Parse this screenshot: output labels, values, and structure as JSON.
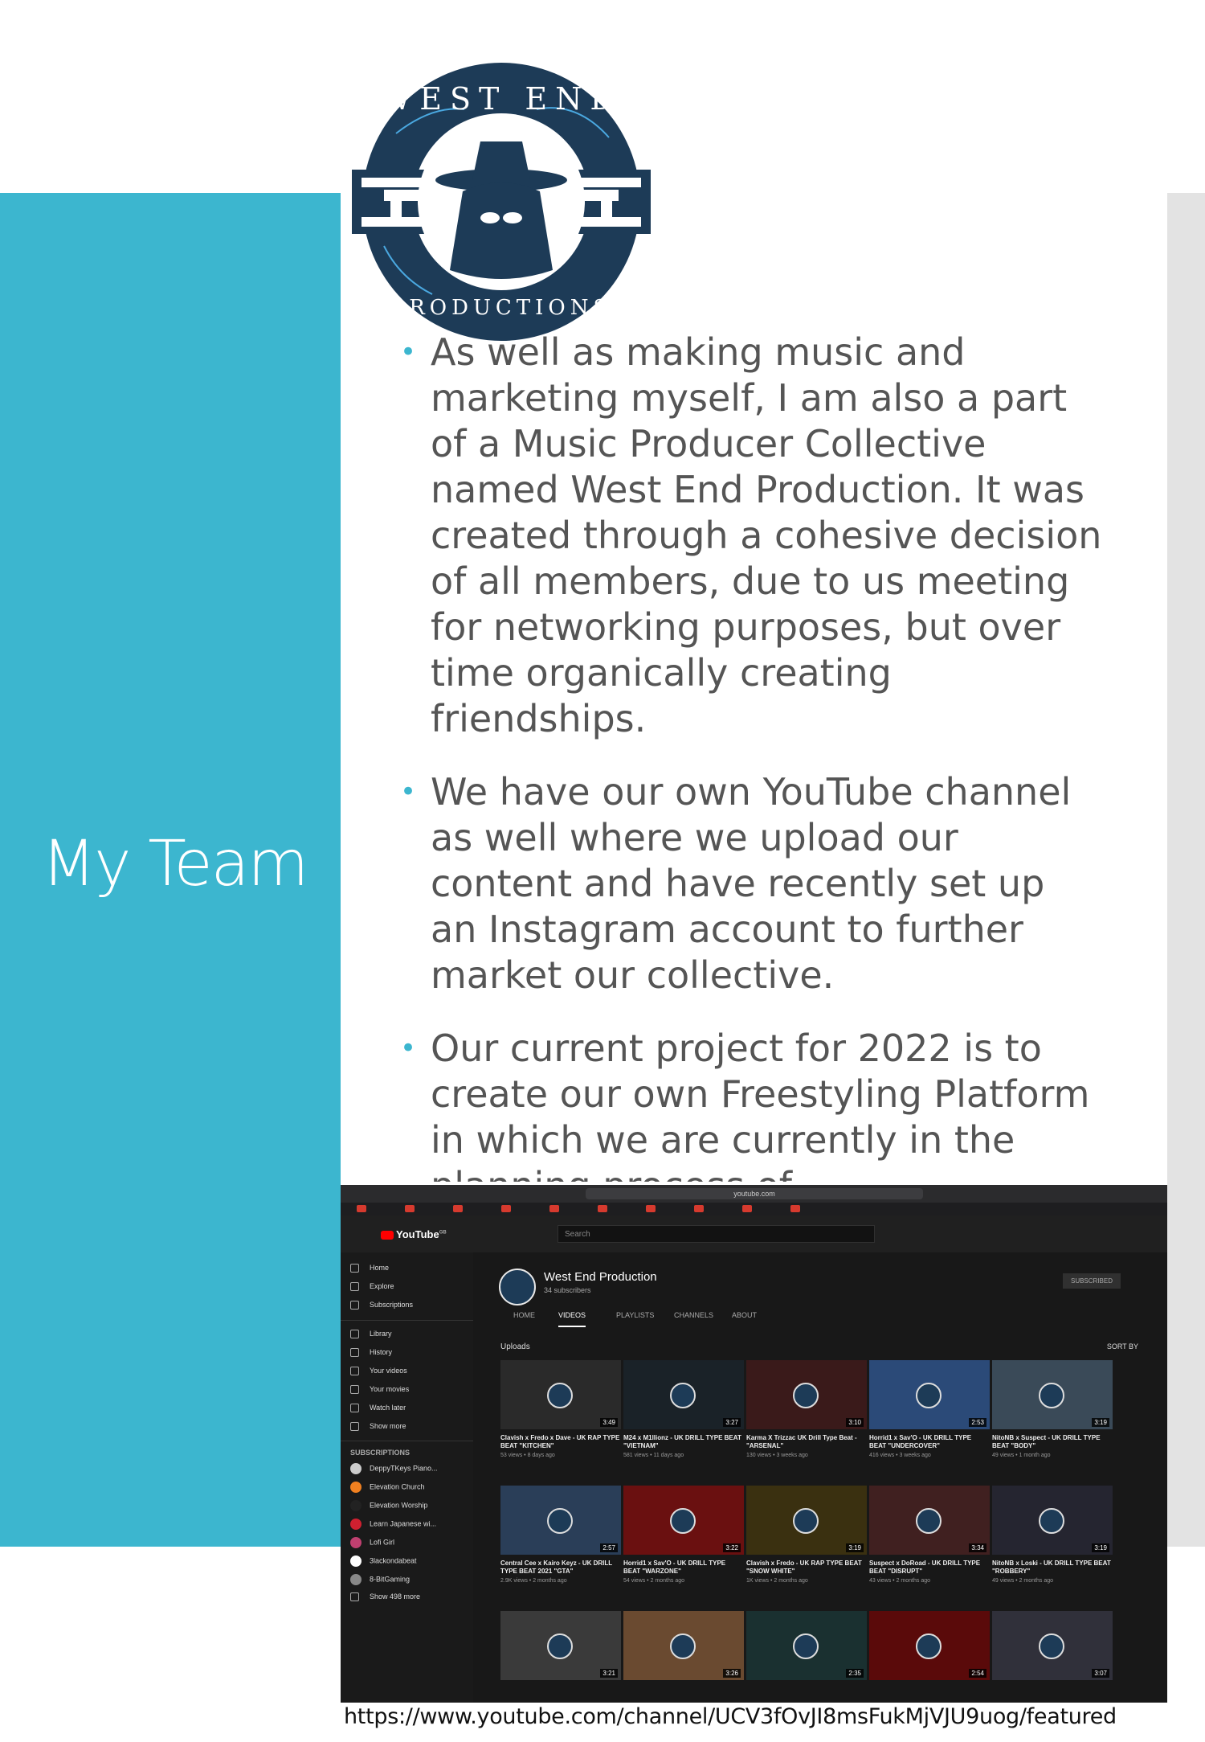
{
  "slide": {
    "title": "My Team",
    "bullets": [
      "As well as making music and marketing myself, I am also a part of a Music Producer Collective named West End Production. It was created through a cohesive decision of all members, due to us meeting for networking purposes, but over time organically creating friendships.",
      "We have our own YouTube channel as well where we upload our content and have recently set up an Instagram account to further market our collective.",
      "Our current project for 2022 is to create our own Freestyling Platform in which we are currently in the planning process of."
    ],
    "link": "https://www.youtube.com/channel/UCV3fOvJI8msFukMjVJU9uog/featured",
    "logo": {
      "top_text": "WEST END",
      "bottom_text": "PRODUCTIONS"
    },
    "colors": {
      "accent": "#3cb6cf",
      "text": "#555555",
      "logo_navy": "#1d3b57"
    }
  },
  "youtube": {
    "url": "youtube.com",
    "logo_text": "YouTube",
    "logo_sup": "GB",
    "search_placeholder": "Search",
    "sidebar": {
      "main": [
        "Home",
        "Explore",
        "Subscriptions"
      ],
      "library": [
        "Library",
        "History",
        "Your videos",
        "Your movies",
        "Watch later",
        "Show more"
      ],
      "subscriptions_label": "SUBSCRIPTIONS",
      "subscriptions": [
        "DeppyTKeys Piano...",
        "Elevation Church",
        "Elevation Worship",
        "Learn Japanese wi...",
        "Lofi Girl",
        "3lackondabeat",
        "8-BitGaming",
        "Show 498 more"
      ]
    },
    "channel": {
      "name": "West End Production",
      "subs": "34 subscribers",
      "subscribe_label": "SUBSCRIBED",
      "tabs": [
        "HOME",
        "VIDEOS",
        "PLAYLISTS",
        "CHANNELS",
        "ABOUT"
      ],
      "uploads_label": "Uploads",
      "sort_label": "SORT BY"
    },
    "videos": [
      {
        "title": "Clavish x Fredo x Dave - UK RAP TYPE BEAT \"KITCHEN\"",
        "meta": "53 views • 8 days ago",
        "dur": "3:49",
        "color": "#2a2a2a"
      },
      {
        "title": "M24 x M1llionz - UK DRILL TYPE BEAT \"VIETNAM\"",
        "meta": "581 views • 11 days ago",
        "dur": "3:27",
        "color": "#1a2228"
      },
      {
        "title": "Karma X Trizzac UK Drill Type Beat - \"ARSENAL\"",
        "meta": "130 views • 3 weeks ago",
        "dur": "3:10",
        "color": "#3a1a1a"
      },
      {
        "title": "Horrid1 x Sav'O - UK DRILL TYPE BEAT \"UNDERCOVER\"",
        "meta": "416 views • 3 weeks ago",
        "dur": "2:53",
        "color": "#2b4a78"
      },
      {
        "title": "NitoNB x Suspect - UK DRILL TYPE BEAT \"BODY\"",
        "meta": "49 views • 1 month ago",
        "dur": "3:19",
        "color": "#3a4a58"
      },
      {
        "title": "Central Cee x Kairo Keyz - UK DRILL TYPE BEAT 2021 \"GTA\"",
        "meta": "2.9K views • 2 months ago",
        "dur": "2:57",
        "color": "#2a3e58"
      },
      {
        "title": "Horrid1 x Sav'O - UK DRILL TYPE BEAT \"WARZONE\"",
        "meta": "54 views • 2 months ago",
        "dur": "3:22",
        "color": "#6a1010"
      },
      {
        "title": "Clavish x Fredo - UK RAP TYPE BEAT \"SNOW WHITE\"",
        "meta": "1K views • 2 months ago",
        "dur": "3:19",
        "color": "#3a3010"
      },
      {
        "title": "Suspect x DoRoad - UK DRILL TYPE BEAT \"DISRUPT\"",
        "meta": "43 views • 2 months ago",
        "dur": "3:34",
        "color": "#402020"
      },
      {
        "title": "NitoNB x Loski - UK DRILL TYPE BEAT \"ROBBERY\"",
        "meta": "49 views • 2 months ago",
        "dur": "3:19",
        "color": "#252530"
      },
      {
        "title": "",
        "meta": "",
        "dur": "3:21",
        "color": "#3a3a3a"
      },
      {
        "title": "",
        "meta": "",
        "dur": "3:26",
        "color": "#6a4a30"
      },
      {
        "title": "",
        "meta": "",
        "dur": "2:35",
        "color": "#1a3030"
      },
      {
        "title": "",
        "meta": "",
        "dur": "2:54",
        "color": "#5a0a0a"
      },
      {
        "title": "",
        "meta": "",
        "dur": "3:07",
        "color": "#30303a"
      }
    ]
  }
}
